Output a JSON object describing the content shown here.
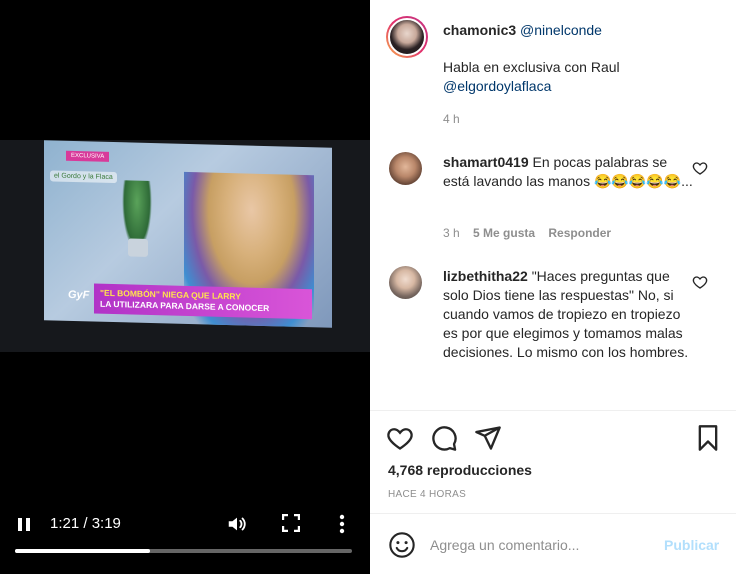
{
  "video": {
    "screen": {
      "tag": "EXCLUSIVA",
      "show": "el Gordo y la Flaca",
      "lower_third_line1": "\"EL BOMBÓN\" NIEGA QUE LARRY",
      "lower_third_line2": "LA UTILIZARA PARA DARSE A CONOCER",
      "logo": "GyF"
    },
    "time_display": "1:21 / 3:19",
    "progress_fraction": 0.4
  },
  "post": {
    "author": "chamonic3",
    "mention": "@ninelconde",
    "caption_line1": "Habla en exclusiva con Raul",
    "caption_mention": "@elgordoylaflaca",
    "caption_time": "4 h"
  },
  "comments": [
    {
      "user": "shamart0419",
      "text": "En pocas palabras se está lavando las manos 😂😂😂😂😂...",
      "time": "3 h",
      "likes": "5 Me gusta",
      "reply": "Responder"
    },
    {
      "user": "lizbethitha22",
      "text": "\"Haces preguntas que solo Dios tiene las respuestas\" No, si cuando vamos de tropiezo en tropiezo es por que elegimos y tomamos malas decisiones. Lo mismo con los hombres."
    }
  ],
  "stats": {
    "views": "4,768 reproducciones",
    "ago": "HACE 4 HORAS"
  },
  "add_comment": {
    "placeholder": "Agrega un comentario...",
    "publish_label": "Publicar"
  },
  "colors": {
    "link": "#00376b",
    "publish_disabled": "#b2dffc",
    "meta": "#8e8e8e"
  }
}
